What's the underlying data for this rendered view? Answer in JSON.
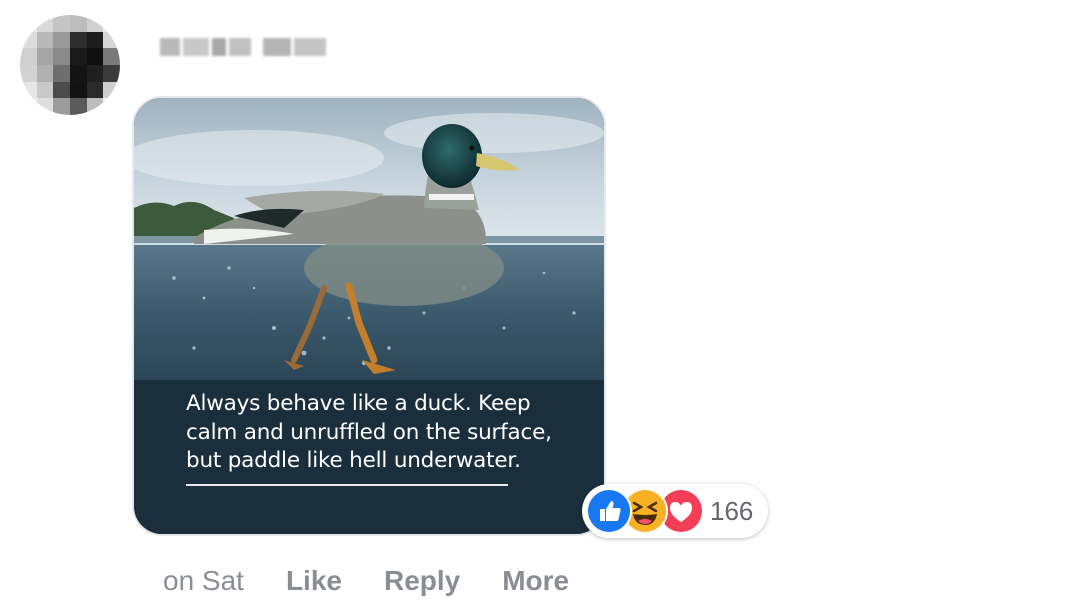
{
  "comment": {
    "author_name": "",
    "image_caption": {
      "lines": [
        "Always behave like a duck. Keep",
        "calm and unruffled on the surface,",
        "but paddle like hell underwater."
      ]
    },
    "reactions": {
      "icons": [
        "like-icon",
        "haha-icon",
        "love-icon"
      ],
      "count": "166"
    },
    "timestamp": "on Sat",
    "actions": {
      "like_label": "Like",
      "reply_label": "Reply",
      "more_label": "More"
    }
  },
  "colors": {
    "like_blue": "#1877f2",
    "haha_yellow": "#f7b125",
    "love_red": "#f33e58",
    "meta_text": "#8a8d91",
    "caption_panel": "#1b2e3c"
  }
}
